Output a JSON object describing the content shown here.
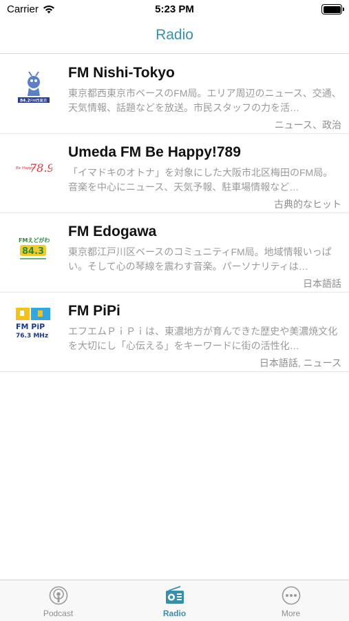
{
  "status_bar": {
    "carrier": "Carrier",
    "time": "5:23 PM"
  },
  "nav": {
    "title": "Radio"
  },
  "stations": [
    {
      "name": "FM Nishi-Tokyo",
      "description": "東京都西東京市ベースのFM局。エリア周辺のニュース、交通、天気情報、話題などを放送。市民スタッフの力を活…",
      "tags": "ニュース、政治",
      "logo_text": "FM西東京",
      "logo_number": "84.2"
    },
    {
      "name": "Umeda FM Be Happy!789",
      "description": "「イマドキのオトナ」を対象にした大阪市北区梅田のFM局。音楽を中心にニュース、天気予報、駐車場情報など…",
      "tags": "古典的なヒット",
      "logo_text": "Be Happy!",
      "logo_number": "78.9"
    },
    {
      "name": "FM Edogawa",
      "description": "東京都江戸川区ベースのコミュニティFM局。地域情報いっぱい。そして心の琴線を震わす音楽。パーソナリティは…",
      "tags": "日本語話",
      "logo_text": "FMえどがわ",
      "logo_number": "84.3"
    },
    {
      "name": "FM PiPi",
      "description": "エフエムＰｉＰｉは、東濃地方が育んできた歴史や美濃焼文化を大切にし「心伝える」をキーワードに街の活性化…",
      "tags": "日本語話, ニュース",
      "logo_text": "FM PiP",
      "logo_number": "76.3 MHz"
    }
  ],
  "tabs": [
    {
      "label": "Podcast",
      "icon": "podcast-icon",
      "active": false
    },
    {
      "label": "Radio",
      "icon": "radio-icon",
      "active": true
    },
    {
      "label": "More",
      "icon": "more-icon",
      "active": false
    }
  ],
  "colors": {
    "accent": "#3a8fa8",
    "inactive": "#8e8e8e",
    "description": "#9a9a9a"
  }
}
